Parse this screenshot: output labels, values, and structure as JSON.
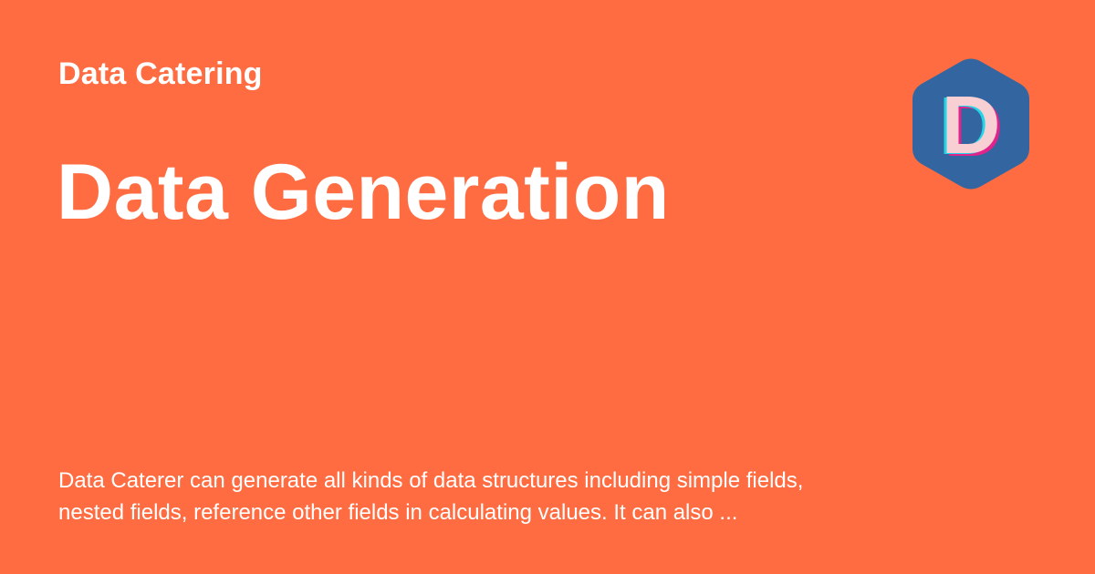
{
  "site": {
    "name": "Data Catering"
  },
  "page": {
    "title": "Data Generation",
    "description": "Data Caterer can generate all kinds of data structures including simple fields, nested fields, reference other fields in calculating values. It can also ..."
  },
  "logo": {
    "letter": "D",
    "icon": "hexagon-logo-icon",
    "colors": {
      "hexagon": "#3366A0",
      "letter_fill": "#F8CFD2",
      "letter_shadow_magenta": "#E0248C",
      "letter_shadow_cyan": "#22D6E8"
    }
  },
  "colors": {
    "background": "#FF6C41",
    "text": "#FFFFFF"
  }
}
